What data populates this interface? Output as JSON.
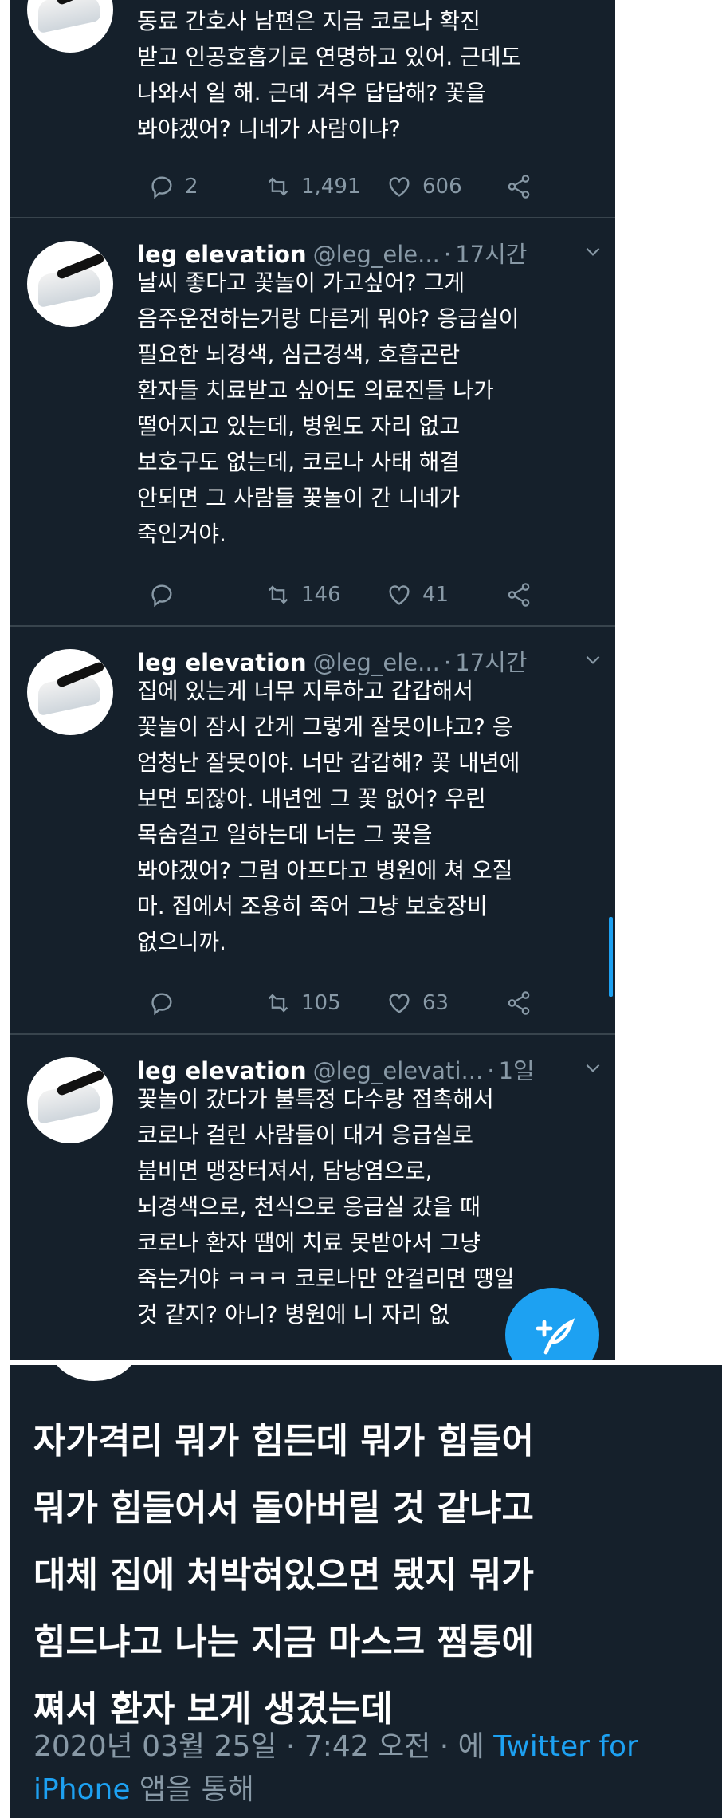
{
  "tweets": [
    {
      "name": "",
      "handle": "",
      "time": "",
      "text": "동료 간호사 남편은 지금 코로나 확진\n받고 인공호흡기로 연명하고 있어. 근데도\n나와서 일 해. 근데 겨우 답답해? 꽃을\n봐야겠어? 니네가 사람이냐?",
      "replies": "2",
      "retweets": "1,491",
      "likes": "606"
    },
    {
      "name": "leg elevation",
      "handle": "@leg_ele...",
      "time": "17시간",
      "text": "날씨 좋다고 꽃놀이 가고싶어? 그게\n음주운전하는거랑 다른게 뭐야? 응급실이\n필요한 뇌경색, 심근경색, 호흡곤란\n환자들 치료받고 싶어도 의료진들 나가\n떨어지고 있는데, 병원도 자리 없고\n보호구도 없는데, 코로나 사태 해결\n안되면 그 사람들 꽃놀이 간 니네가\n죽인거야.",
      "replies": "",
      "retweets": "146",
      "likes": "41"
    },
    {
      "name": "leg elevation",
      "handle": "@leg_ele...",
      "time": "17시간",
      "text": "집에 있는게 너무 지루하고 갑갑해서\n꽃놀이 잠시 간게 그렇게 잘못이냐고? 응\n엄청난 잘못이야. 너만 갑갑해? 꽃 내년에\n보면 되잖아. 내년엔 그 꽃 없어? 우린\n목숨걸고 일하는데 너는 그 꽃을\n봐야겠어? 그럼 아프다고 병원에 쳐 오질\n마. 집에서 조용히 죽어 그냥 보호장비\n없으니까.",
      "replies": "",
      "retweets": "105",
      "likes": "63"
    },
    {
      "name": "leg elevation",
      "handle": "@leg_elevati...",
      "time": "1일",
      "text": "꽃놀이 갔다가 불특정 다수랑 접촉해서\n코로나 걸린 사람들이 대거 응급실로\n붐비면 맹장터져서, 담낭염으로,\n뇌경색으로, 천식으로 응급실 갔을 때\n코로나 환자 땜에 치료 못받아서 그냥\n죽는거야 ㅋㅋㅋ 코로나만 안걸리면 땡일\n것 같지? 아니? 병원에 니 자리 없",
      "replies": "",
      "retweets": "",
      "likes": ""
    }
  ],
  "detail": {
    "text": "자가격리 뭐가 힘든데 뭐가 힘들어\n뭐가 힘들어서 돌아버릴 것 같냐고\n대체 집에 처박혀있으면 됐지 뭐가\n힘드냐고 나는 지금 마스크 찜통에\n쪄서 환자 보게 생겼는데",
    "date": "2020년 03월 25일 · 7:42 오전 · 에",
    "source": "Twitter for iPhone",
    "suffix": "앱을 통해"
  },
  "colors": {
    "background": "#15202b",
    "text": "#ffffff",
    "secondary": "#8899a6",
    "accent": "#1da1f2",
    "divider": "#38444d"
  },
  "icons": [
    "reply-icon",
    "retweet-icon",
    "like-icon",
    "share-icon",
    "chevron-down-icon",
    "compose-tweet-icon"
  ]
}
